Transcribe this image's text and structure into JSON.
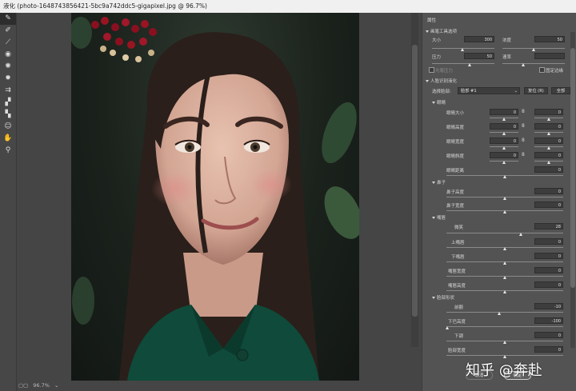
{
  "window_title": "液化 (photo-1648743856421-5bc9a742ddc5-gigapixel.jpg @ 96.7%)",
  "toolbar": {
    "tools": [
      "forward-warp-icon",
      "reconstruct-icon",
      "smooth-icon",
      "twirl-icon",
      "pucker-icon",
      "bloat-icon",
      "push-left-icon",
      "freeze-mask-icon",
      "thaw-mask-icon",
      "face-tool-icon",
      "hand-icon",
      "zoom-icon"
    ]
  },
  "status": {
    "zoom": "96.7%"
  },
  "panel": {
    "header": "属性",
    "brush_section": {
      "title": "画笔工具选项",
      "size_label": "大小",
      "size_value": "300",
      "density_label": "浓度",
      "density_value": "50",
      "pressure_label": "压力",
      "pressure_value": "50",
      "rate_label": "速率",
      "rate_value": "",
      "stylus_label": "光笔压力",
      "pin_edges_label": "固定边缘"
    },
    "face_section": {
      "title": "人脸识别液化",
      "select_face_label": "选择脸部:",
      "select_face_value": "脸部 #1",
      "reset_label": "复位 (R)",
      "all_label": "全部"
    },
    "eyes": {
      "title": "眼睛",
      "rows": [
        {
          "label": "眼睛大小",
          "left": "0",
          "right": "0"
        },
        {
          "label": "眼睛高度",
          "left": "0",
          "right": "0"
        },
        {
          "label": "眼睛宽度",
          "left": "0",
          "right": "0"
        },
        {
          "label": "眼睛斜度",
          "left": "0",
          "right": "0"
        },
        {
          "label": "眼睛距离",
          "value": "0"
        }
      ]
    },
    "nose": {
      "title": "鼻子",
      "rows": [
        {
          "label": "鼻子高度",
          "value": "0"
        },
        {
          "label": "鼻子宽度",
          "value": "0"
        }
      ]
    },
    "mouth": {
      "title": "嘴唇",
      "rows": [
        {
          "label": "微笑",
          "value": "28"
        },
        {
          "label": "上嘴唇",
          "value": "0"
        },
        {
          "label": "下嘴唇",
          "value": "0"
        },
        {
          "label": "嘴唇宽度",
          "value": "0"
        },
        {
          "label": "嘴唇高度",
          "value": "0"
        }
      ]
    },
    "face_shape": {
      "title": "脸部形状",
      "rows": [
        {
          "label": "前额",
          "value": "-10"
        },
        {
          "label": "下巴高度",
          "value": "-100"
        },
        {
          "label": "下颌",
          "value": "0"
        },
        {
          "label": "脸部宽度",
          "value": "0"
        }
      ]
    },
    "buttons": {
      "cancel": "取消",
      "ok": "确定"
    }
  },
  "watermark": "知乎 @奔赴",
  "colors": {
    "panel_bg": "#535353",
    "canvas_bg": "#454545",
    "sweater": "#0f4a3a"
  }
}
